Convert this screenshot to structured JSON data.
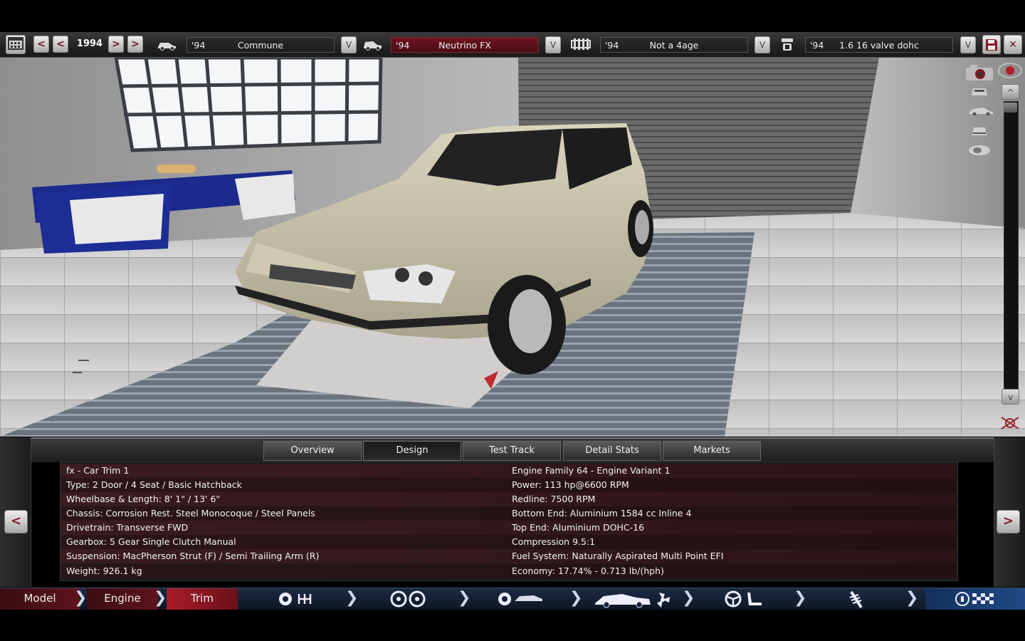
{
  "topbar": {
    "calendar_icon": "calendar-icon",
    "prev_prev": "<",
    "prev": "<",
    "year": "1994",
    "next": ">",
    "next_next": ">",
    "model": {
      "year": "'94",
      "name": "Commune"
    },
    "trim": {
      "year": "'94",
      "name": "Neutrino FX"
    },
    "engine_family": {
      "year": "'94",
      "name": "Not a 4age"
    },
    "engine_variant": {
      "year": "'94",
      "name": "1.6 16 valve dohc"
    },
    "dropdown": "V",
    "close": "✕"
  },
  "scene": {
    "scroll_up": "^",
    "scroll_down": "v",
    "accent_red": "#8b1a24"
  },
  "tabs": [
    {
      "label": "Overview"
    },
    {
      "label": "Design"
    },
    {
      "label": "Test Track"
    },
    {
      "label": "Detail Stats"
    },
    {
      "label": "Markets"
    }
  ],
  "details": {
    "left": [
      "fx - Car Trim 1",
      "Type: 2 Door / 4 Seat / Basic Hatchback",
      "Wheelbase & Length: 8' 1\" / 13' 6\"",
      "Chassis: Corrosion Rest. Steel Monocoque / Steel Panels",
      "Drivetrain: Transverse FWD",
      "Gearbox: 5 Gear Single Clutch Manual",
      "Suspension: MacPherson Strut (F) / Semi Trailing Arm (R)",
      "Weight: 926.1 kg"
    ],
    "right": [
      "Engine Family 64 - Engine Variant 1",
      "Power: 113 hp@6600 RPM",
      "Redline: 7500 RPM",
      "Bottom End: Aluminium 1584 cc Inline 4",
      "Top End: Aluminium DOHC-16",
      "Compression 9.5:1",
      "Fuel System: Naturally Aspirated Multi Point EFI",
      "Economy: 17.74% - 0.713 lb/(hph)"
    ]
  },
  "nav": {
    "prev": "<",
    "next": ">"
  },
  "bottom": {
    "model": "Model",
    "engine": "Engine",
    "trim": "Trim"
  }
}
